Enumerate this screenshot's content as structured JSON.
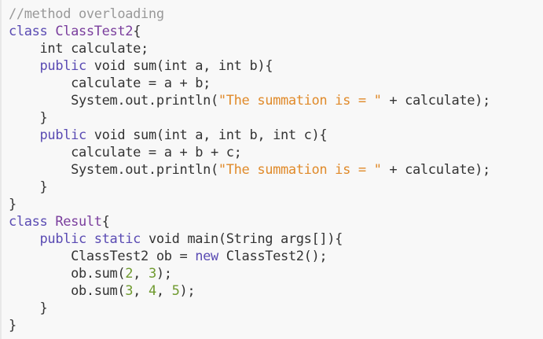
{
  "colors": {
    "background": "#f8f8f8",
    "text": "#333333",
    "comment": "#999999",
    "keyword": "#5a4bb3",
    "class_name": "#7a3e9d",
    "string": "#e08a2a",
    "number": "#6f9a2f"
  },
  "code": {
    "language": "java",
    "lines": [
      [
        {
          "t": "comment",
          "v": "//method overloading"
        }
      ],
      [
        {
          "t": "keyword",
          "v": "class"
        },
        {
          "t": "plain",
          "v": " "
        },
        {
          "t": "class",
          "v": "ClassTest2"
        },
        {
          "t": "plain",
          "v": "{"
        }
      ],
      [
        {
          "t": "plain",
          "v": "    int calculate;"
        }
      ],
      [
        {
          "t": "plain",
          "v": "    "
        },
        {
          "t": "keyword",
          "v": "public"
        },
        {
          "t": "plain",
          "v": " void sum(int a, int b){"
        }
      ],
      [
        {
          "t": "plain",
          "v": "        calculate = a + b;"
        }
      ],
      [
        {
          "t": "plain",
          "v": "        System.out.println("
        },
        {
          "t": "string",
          "v": "\"The summation is = \""
        },
        {
          "t": "plain",
          "v": " + calculate);"
        }
      ],
      [
        {
          "t": "plain",
          "v": "    }"
        }
      ],
      [
        {
          "t": "plain",
          "v": "    "
        },
        {
          "t": "keyword",
          "v": "public"
        },
        {
          "t": "plain",
          "v": " void sum(int a, int b, int c){"
        }
      ],
      [
        {
          "t": "plain",
          "v": "        calculate = a + b + c;"
        }
      ],
      [
        {
          "t": "plain",
          "v": "        System.out.println("
        },
        {
          "t": "string",
          "v": "\"The summation is = \""
        },
        {
          "t": "plain",
          "v": " + calculate);"
        }
      ],
      [
        {
          "t": "plain",
          "v": "    }"
        }
      ],
      [
        {
          "t": "plain",
          "v": "}"
        }
      ],
      [
        {
          "t": "keyword",
          "v": "class"
        },
        {
          "t": "plain",
          "v": " "
        },
        {
          "t": "class",
          "v": "Result"
        },
        {
          "t": "plain",
          "v": "{"
        }
      ],
      [
        {
          "t": "plain",
          "v": "    "
        },
        {
          "t": "keyword",
          "v": "public"
        },
        {
          "t": "plain",
          "v": " "
        },
        {
          "t": "keyword",
          "v": "static"
        },
        {
          "t": "plain",
          "v": " void main(String args[]){"
        }
      ],
      [
        {
          "t": "plain",
          "v": "        ClassTest2 ob = "
        },
        {
          "t": "keyword",
          "v": "new"
        },
        {
          "t": "plain",
          "v": " ClassTest2();"
        }
      ],
      [
        {
          "t": "plain",
          "v": "        ob.sum("
        },
        {
          "t": "number",
          "v": "2"
        },
        {
          "t": "plain",
          "v": ", "
        },
        {
          "t": "number",
          "v": "3"
        },
        {
          "t": "plain",
          "v": ");"
        }
      ],
      [
        {
          "t": "plain",
          "v": "        ob.sum("
        },
        {
          "t": "number",
          "v": "3"
        },
        {
          "t": "plain",
          "v": ", "
        },
        {
          "t": "number",
          "v": "4"
        },
        {
          "t": "plain",
          "v": ", "
        },
        {
          "t": "number",
          "v": "5"
        },
        {
          "t": "plain",
          "v": ");"
        }
      ],
      [
        {
          "t": "plain",
          "v": "    }"
        }
      ],
      [
        {
          "t": "plain",
          "v": "}"
        }
      ]
    ]
  }
}
